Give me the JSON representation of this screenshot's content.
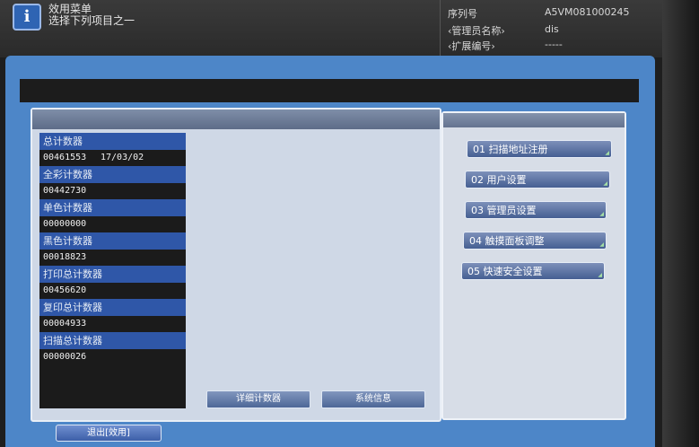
{
  "header": {
    "title_line1": "效用菜单",
    "title_line2": "选择下列项目之一",
    "serial_label": "序列号",
    "serial_value": "A5VM081000245",
    "admin_label": "‹管理员名称›",
    "admin_value": "dis",
    "ext_label": "‹扩展编号›",
    "ext_value": "-----"
  },
  "counters": [
    {
      "label": "总计数器",
      "value": "00461553",
      "date": "17/03/02"
    },
    {
      "label": "全彩计数器",
      "value": "00442730"
    },
    {
      "label": "单色计数器",
      "value": "00000000"
    },
    {
      "label": "黑色计数器",
      "value": "00018823"
    },
    {
      "label": "打印总计数器",
      "value": "00456620"
    },
    {
      "label": "复印总计数器",
      "value": "00004933"
    },
    {
      "label": "扫描总计数器",
      "value": "00000026"
    }
  ],
  "buttons": {
    "detail_counter": "详细计数器",
    "system_info": "系统信息",
    "exit": "退出[效用]"
  },
  "menu": [
    "01 扫描地址注册",
    "02 用户设置",
    "03 管理员设置",
    "04 触摸面板调整",
    "05 快速安全设置"
  ],
  "colors": {
    "accent_blue": "#4d86c8",
    "label_blue": "#2f57a8",
    "button_blue": "#455f92"
  }
}
